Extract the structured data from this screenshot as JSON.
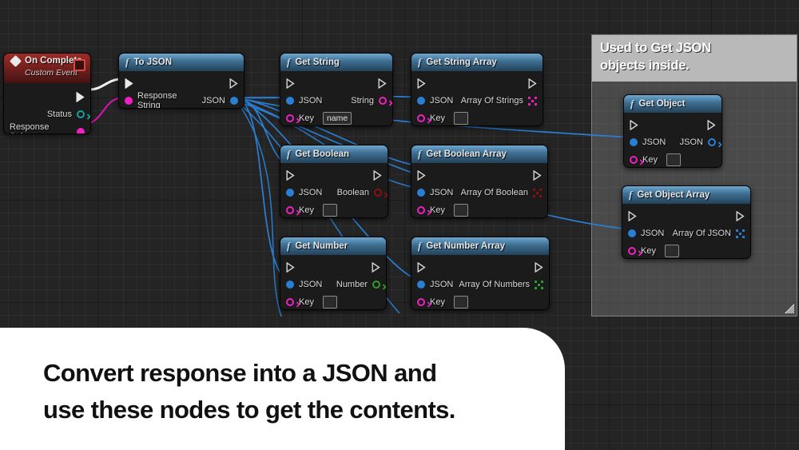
{
  "caption": {
    "text": "Convert response into a JSON and\nuse these nodes to get the contents."
  },
  "comment": {
    "title": "Used to Get JSON\nobjects inside.",
    "color": "#b9b9b9"
  },
  "colors": {
    "exec_white": "#e8e8e8",
    "string_pink": "#f020c0",
    "json_blue": "#2a7fd4",
    "boolean_red": "#8b0f0f",
    "number_green": "#2c9e2c",
    "event_red": "#9e2b26",
    "function_blue": "#3f6f92",
    "node_body": "#1b1b1b",
    "canvas": "#242424"
  },
  "nodes": [
    {
      "id": "on-complete",
      "title": "On Complete",
      "subtitle": "Custom Event",
      "kind": "event",
      "outputs": [
        {
          "label": "",
          "pin": "exec"
        },
        {
          "label": "Status",
          "pin": "hollow-teal"
        },
        {
          "label": "Response String",
          "pin": "filled-pink"
        }
      ]
    },
    {
      "id": "to-json",
      "title": "To JSON",
      "kind": "function",
      "inputs": [
        {
          "label": "",
          "pin": "exec-filled"
        },
        {
          "label": "Response String",
          "pin": "filled-pink"
        }
      ],
      "outputs": [
        {
          "label": "",
          "pin": "exec"
        },
        {
          "label": "JSON",
          "pin": "filled-blue"
        }
      ]
    },
    {
      "id": "get-string",
      "title": "Get String",
      "kind": "function",
      "inputs": [
        {
          "label": "",
          "pin": "exec"
        },
        {
          "label": "JSON",
          "pin": "filled-blue"
        },
        {
          "label": "Key",
          "pin": "hollow-pink",
          "value": "name"
        }
      ],
      "outputs": [
        {
          "label": "",
          "pin": "exec"
        },
        {
          "label": "String",
          "pin": "hollow-pink"
        }
      ]
    },
    {
      "id": "get-string-array",
      "title": "Get String Array",
      "kind": "function",
      "inputs": [
        {
          "label": "",
          "pin": "exec"
        },
        {
          "label": "JSON",
          "pin": "filled-blue"
        },
        {
          "label": "Key",
          "pin": "hollow-pink",
          "value": ""
        }
      ],
      "outputs": [
        {
          "label": "",
          "pin": "exec"
        },
        {
          "label": "Array Of Strings",
          "pin": "array-pink"
        }
      ]
    },
    {
      "id": "get-boolean",
      "title": "Get Boolean",
      "kind": "function",
      "inputs": [
        {
          "label": "",
          "pin": "exec"
        },
        {
          "label": "JSON",
          "pin": "filled-blue"
        },
        {
          "label": "Key",
          "pin": "hollow-pink",
          "value": ""
        }
      ],
      "outputs": [
        {
          "label": "",
          "pin": "exec"
        },
        {
          "label": "Boolean",
          "pin": "hollow-red"
        }
      ]
    },
    {
      "id": "get-boolean-array",
      "title": "Get Boolean Array",
      "kind": "function",
      "inputs": [
        {
          "label": "",
          "pin": "exec"
        },
        {
          "label": "JSON",
          "pin": "filled-blue"
        },
        {
          "label": "Key",
          "pin": "hollow-pink",
          "value": ""
        }
      ],
      "outputs": [
        {
          "label": "",
          "pin": "exec"
        },
        {
          "label": "Array Of Boolean",
          "pin": "array-red"
        }
      ]
    },
    {
      "id": "get-number",
      "title": "Get Number",
      "kind": "function",
      "inputs": [
        {
          "label": "",
          "pin": "exec"
        },
        {
          "label": "JSON",
          "pin": "filled-blue"
        },
        {
          "label": "Key",
          "pin": "hollow-pink",
          "value": ""
        }
      ],
      "outputs": [
        {
          "label": "",
          "pin": "exec"
        },
        {
          "label": "Number",
          "pin": "hollow-green"
        }
      ]
    },
    {
      "id": "get-number-array",
      "title": "Get Number Array",
      "kind": "function",
      "inputs": [
        {
          "label": "",
          "pin": "exec"
        },
        {
          "label": "JSON",
          "pin": "filled-blue"
        },
        {
          "label": "Key",
          "pin": "hollow-pink",
          "value": ""
        }
      ],
      "outputs": [
        {
          "label": "",
          "pin": "exec"
        },
        {
          "label": "Array Of Numbers",
          "pin": "array-green"
        }
      ]
    },
    {
      "id": "get-object",
      "title": "Get Object",
      "kind": "function",
      "inputs": [
        {
          "label": "",
          "pin": "exec"
        },
        {
          "label": "JSON",
          "pin": "filled-blue"
        },
        {
          "label": "Key",
          "pin": "hollow-pink",
          "value": ""
        }
      ],
      "outputs": [
        {
          "label": "",
          "pin": "exec"
        },
        {
          "label": "JSON",
          "pin": "hollow-blue"
        }
      ]
    },
    {
      "id": "get-object-array",
      "title": "Get Object Array",
      "kind": "function",
      "inputs": [
        {
          "label": "",
          "pin": "exec"
        },
        {
          "label": "JSON",
          "pin": "filled-blue"
        },
        {
          "label": "Key",
          "pin": "hollow-pink",
          "value": ""
        }
      ],
      "outputs": [
        {
          "label": "",
          "pin": "exec"
        },
        {
          "label": "Array Of JSON",
          "pin": "array-blue"
        }
      ]
    }
  ],
  "labels": {
    "fn_glyph": "f",
    "status": "Status",
    "key": "Key",
    "json": "JSON"
  }
}
